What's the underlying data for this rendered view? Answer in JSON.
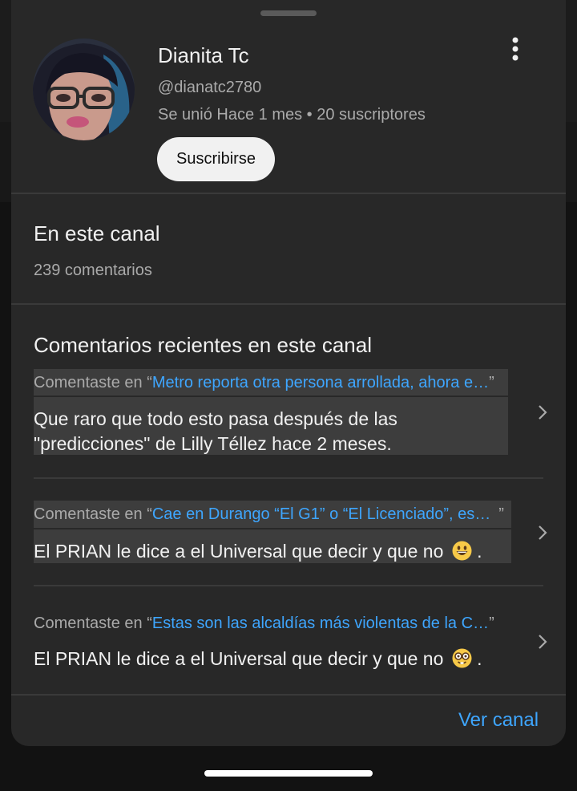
{
  "channel": {
    "name": "Dianita Tc",
    "handle": "@dianatc2780",
    "meta": "Se unió Hace 1 mes • 20 suscriptores",
    "subscribe_label": "Suscribirse"
  },
  "on_channel": {
    "title": "En este canal",
    "count": "239 comentarios"
  },
  "recent": {
    "title": "Comentarios recientes en este canal",
    "items": [
      {
        "prefix": "Comentaste en “",
        "video": "Metro reporta otra persona arrollada, ahora e…",
        "suffix": "”",
        "lines": [
          "Que raro que todo esto pasa después de las",
          "\"predicciones\" de Lilly Téllez hace 2 meses."
        ],
        "emoji": ""
      },
      {
        "prefix": "Comentaste en “",
        "video": "Cae en Durango “El G1” o “El Licenciado”, es…",
        "suffix": "”",
        "lines": [
          "El PRIAN le dice a el Universal que decir y que no"
        ],
        "emoji": "grinning-face"
      },
      {
        "prefix": "Comentaste en “",
        "video": "Estas son las alcaldías más violentas de la C…",
        "suffix": "”",
        "lines": [
          "El PRIAN le dice a el Universal que decir y que no"
        ],
        "emoji": "nerd-face"
      }
    ]
  },
  "footer": {
    "link": "Ver canal"
  },
  "colors": {
    "sheet": "#282828",
    "link": "#3ea6ff",
    "secondary_text": "#aaaaaa",
    "primary_text": "#f1f1f1"
  }
}
